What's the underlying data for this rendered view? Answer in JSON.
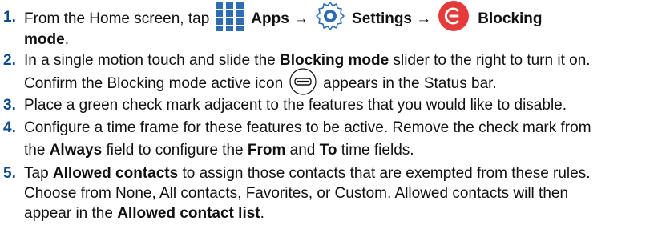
{
  "colors": {
    "step_number": "#0d4a8c",
    "apps_blue": "#2f6db3",
    "blocking_red": "#e53a3a",
    "settings_blue": "#2f6db3"
  },
  "icons": [
    "apps-grid-icon",
    "settings-gear-icon",
    "blocking-mode-icon",
    "blocking-active-status-icon"
  ],
  "steps": [
    {
      "num": "1.",
      "a": "From the Home screen, tap",
      "apps": "Apps",
      "arrow1": "→",
      "settings": "Settings",
      "arrow2": "→",
      "blocking": "Blocking",
      "mode": "mode",
      "end": "."
    },
    {
      "num": "2.",
      "a": "In a single motion touch and slide the",
      "b": "Blocking mode",
      "c": "slider to the right to turn it on.",
      "d": "Confirm the Blocking mode active icon",
      "e": "appears in the Status bar."
    },
    {
      "num": "3.",
      "a": "Place a green check mark adjacent to the features that you would like to disable."
    },
    {
      "num": "4.",
      "a": "Configure a time frame for these features to be active. Remove the check mark from",
      "b": "the",
      "c": "Always",
      "d": "field to configure the",
      "e": "From",
      "f": "and",
      "g": "To",
      "h": "time fields."
    },
    {
      "num": "5.",
      "a": "Tap",
      "b": "Allowed contacts",
      "c": "to assign those contacts that are exempted from these rules.",
      "d": "Choose from None, All contacts, Favorites, or Custom. Allowed contacts will then",
      "e": "appear in the",
      "f": "Allowed contact list",
      "g": "."
    }
  ]
}
